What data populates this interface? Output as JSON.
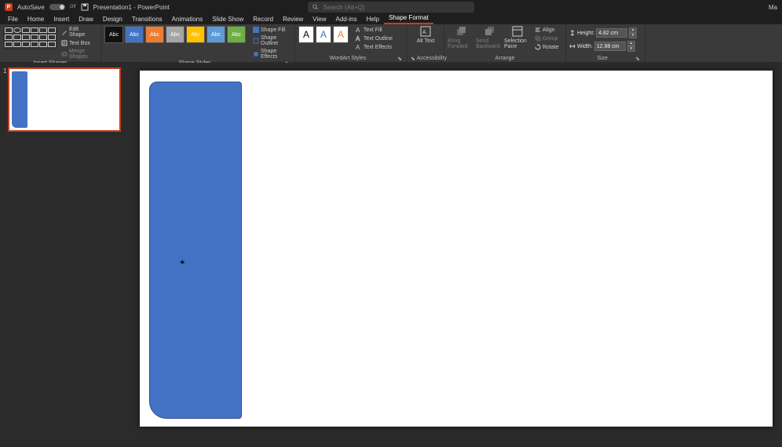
{
  "title": {
    "autosave_label": "AutoSave",
    "autosave_state": "Off",
    "doc": "Presentation1 - PowerPoint",
    "search_placeholder": "Search (Alt+Q)",
    "user": "Ma"
  },
  "tabs": {
    "file": "File",
    "home": "Home",
    "insert": "Insert",
    "draw": "Draw",
    "design": "Design",
    "transitions": "Transitions",
    "animations": "Animations",
    "slideshow": "Slide Show",
    "record": "Record",
    "review": "Review",
    "view": "View",
    "addins": "Add-ins",
    "help": "Help",
    "shapeformat": "Shape Format"
  },
  "ribbon": {
    "insert_shapes": {
      "label": "Insert Shapes",
      "edit_shape": "Edit Shape",
      "text_box": "Text Box",
      "merge_shapes": "Merge Shapes"
    },
    "shape_styles": {
      "label": "Shape Styles",
      "tile_text": "Abc",
      "shape_fill": "Shape Fill",
      "shape_outline": "Shape Outline",
      "shape_effects": "Shape Effects"
    },
    "wordart_styles": {
      "label": "WordArt Styles",
      "tile_text": "A",
      "text_fill": "Text Fill",
      "text_outline": "Text Outline",
      "text_effects": "Text Effects"
    },
    "accessibility": {
      "label": "Accessibility",
      "alt_text": "Alt Text"
    },
    "arrange": {
      "label": "Arrange",
      "bring_forward": "Bring Forward",
      "send_backward": "Send Backward",
      "selection_pane": "Selection Pane",
      "align": "Align",
      "group": "Group",
      "rotate": "Rotate"
    },
    "size": {
      "label": "Size",
      "height_label": "Height:",
      "height_val": "4.82 cm",
      "width_label": "Width:",
      "width_val": "12.98 cm"
    }
  },
  "thumbs": {
    "slide1_num": "1"
  }
}
